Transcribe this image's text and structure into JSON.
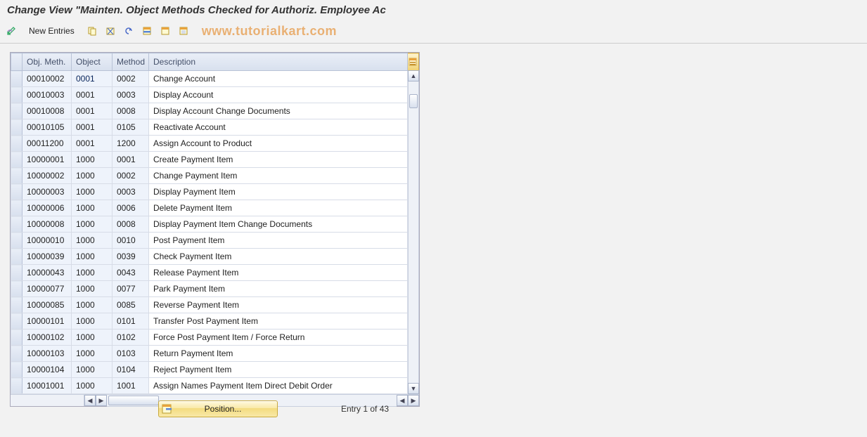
{
  "title": "Change View \"Mainten. Object Methods Checked for Authoriz. Employee Ac",
  "watermark": "www.tutorialkart.com",
  "toolbar": {
    "new_entries_label": "New Entries"
  },
  "table": {
    "headers": {
      "objmeth": "Obj. Meth.",
      "object": "Object",
      "method": "Method",
      "description": "Description"
    },
    "rows": [
      {
        "objmeth": "00010002",
        "object": "0001",
        "method": "0002",
        "desc": "Change Account"
      },
      {
        "objmeth": "00010003",
        "object": "0001",
        "method": "0003",
        "desc": "Display Account"
      },
      {
        "objmeth": "00010008",
        "object": "0001",
        "method": "0008",
        "desc": "Display Account Change Documents"
      },
      {
        "objmeth": "00010105",
        "object": "0001",
        "method": "0105",
        "desc": "Reactivate Account"
      },
      {
        "objmeth": "00011200",
        "object": "0001",
        "method": "1200",
        "desc": "Assign Account to Product"
      },
      {
        "objmeth": "10000001",
        "object": "1000",
        "method": "0001",
        "desc": "Create Payment Item"
      },
      {
        "objmeth": "10000002",
        "object": "1000",
        "method": "0002",
        "desc": "Change Payment Item"
      },
      {
        "objmeth": "10000003",
        "object": "1000",
        "method": "0003",
        "desc": "Display Payment Item"
      },
      {
        "objmeth": "10000006",
        "object": "1000",
        "method": "0006",
        "desc": "Delete Payment Item"
      },
      {
        "objmeth": "10000008",
        "object": "1000",
        "method": "0008",
        "desc": "Display Payment Item Change Documents"
      },
      {
        "objmeth": "10000010",
        "object": "1000",
        "method": "0010",
        "desc": "Post Payment Item"
      },
      {
        "objmeth": "10000039",
        "object": "1000",
        "method": "0039",
        "desc": "Check Payment Item"
      },
      {
        "objmeth": "10000043",
        "object": "1000",
        "method": "0043",
        "desc": "Release Payment Item"
      },
      {
        "objmeth": "10000077",
        "object": "1000",
        "method": "0077",
        "desc": "Park Payment Item"
      },
      {
        "objmeth": "10000085",
        "object": "1000",
        "method": "0085",
        "desc": "Reverse Payment Item"
      },
      {
        "objmeth": "10000101",
        "object": "1000",
        "method": "0101",
        "desc": "Transfer Post Payment Item"
      },
      {
        "objmeth": "10000102",
        "object": "1000",
        "method": "0102",
        "desc": "Force Post Payment Item / Force Return"
      },
      {
        "objmeth": "10000103",
        "object": "1000",
        "method": "0103",
        "desc": "Return Payment Item"
      },
      {
        "objmeth": "10000104",
        "object": "1000",
        "method": "0104",
        "desc": "Reject Payment Item"
      },
      {
        "objmeth": "10001001",
        "object": "1000",
        "method": "1001",
        "desc": "Assign Names Payment Item Direct Debit Order"
      }
    ]
  },
  "footer": {
    "position_label": "Position...",
    "entry_status": "Entry 1 of 43"
  }
}
